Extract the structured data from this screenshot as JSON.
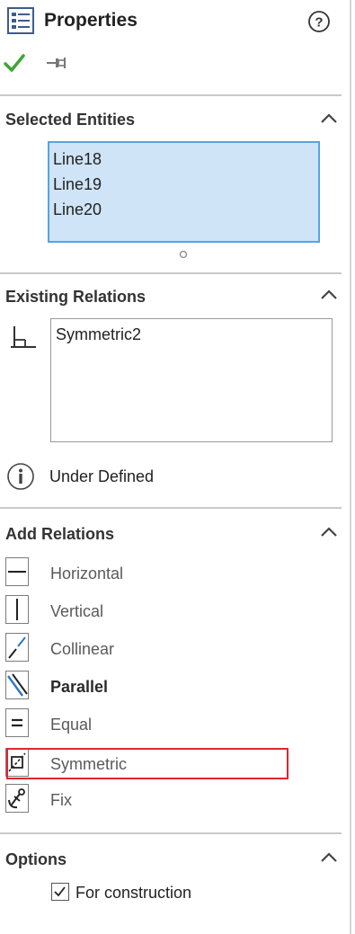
{
  "header": {
    "title": "Properties",
    "help_icon": "help-icon",
    "ok_icon": "checkmark-icon",
    "pin_icon": "pushpin-icon"
  },
  "selected_entities": {
    "title": "Selected Entities",
    "items": [
      "Line18",
      "Line19",
      "Line20"
    ]
  },
  "existing_relations": {
    "title": "Existing Relations",
    "items": [
      "Symmetric2"
    ],
    "status": "Under Defined"
  },
  "add_relations": {
    "title": "Add Relations",
    "items": [
      {
        "label": "Horizontal",
        "icon": "horizontal-icon"
      },
      {
        "label": "Vertical",
        "icon": "vertical-icon"
      },
      {
        "label": "Collinear",
        "icon": "collinear-icon"
      },
      {
        "label": "Parallel",
        "icon": "parallel-icon"
      },
      {
        "label": "Equal",
        "icon": "equal-icon"
      },
      {
        "label": "Symmetric",
        "icon": "symmetric-icon"
      },
      {
        "label": "Fix",
        "icon": "fix-icon"
      }
    ]
  },
  "options": {
    "title": "Options",
    "for_construction_label": "For construction",
    "for_construction_checked": true
  },
  "colors": {
    "accent_selection": "#cfe4f7",
    "selection_border": "#54a4e4",
    "highlight_red": "#e0262b",
    "ok_green": "#3fa535"
  }
}
